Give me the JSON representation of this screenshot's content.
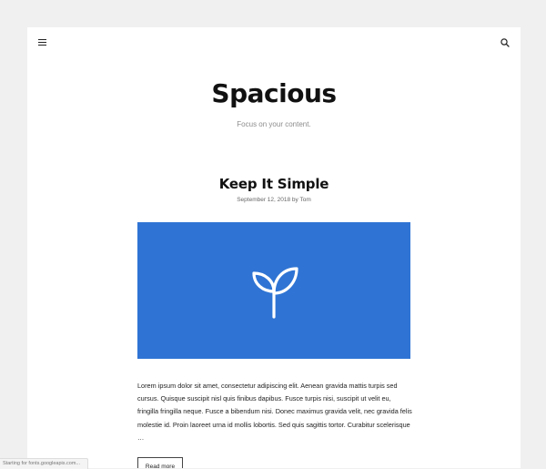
{
  "site": {
    "title": "Spacious",
    "tagline": "Focus on your content."
  },
  "header": {
    "menu_icon": "hamburger-icon",
    "search_icon": "search-icon"
  },
  "post": {
    "title": "Keep It Simple",
    "date": "September 12, 2018",
    "by": "by",
    "author": "Tom",
    "featured_icon": "sprout-icon",
    "featured_bg": "#2f74d4",
    "excerpt": "Lorem ipsum dolor sit amet, consectetur adipiscing elit. Aenean gravida mattis turpis sed cursus. Quisque suscipit nisl quis finibus dapibus. Fusce turpis nisi, suscipit ut velit eu, fringilla fringilla neque. Fusce a bibendum nisi. Donec maximus gravida velit, nec gravida felis molestie id. Proin laoreet urna id mollis lobortis. Sed quis sagittis tortor. Curabitur scelerisque …",
    "read_more": "Read more"
  },
  "status_bar": {
    "text": "Starting for fonts.googleapis.com..."
  }
}
